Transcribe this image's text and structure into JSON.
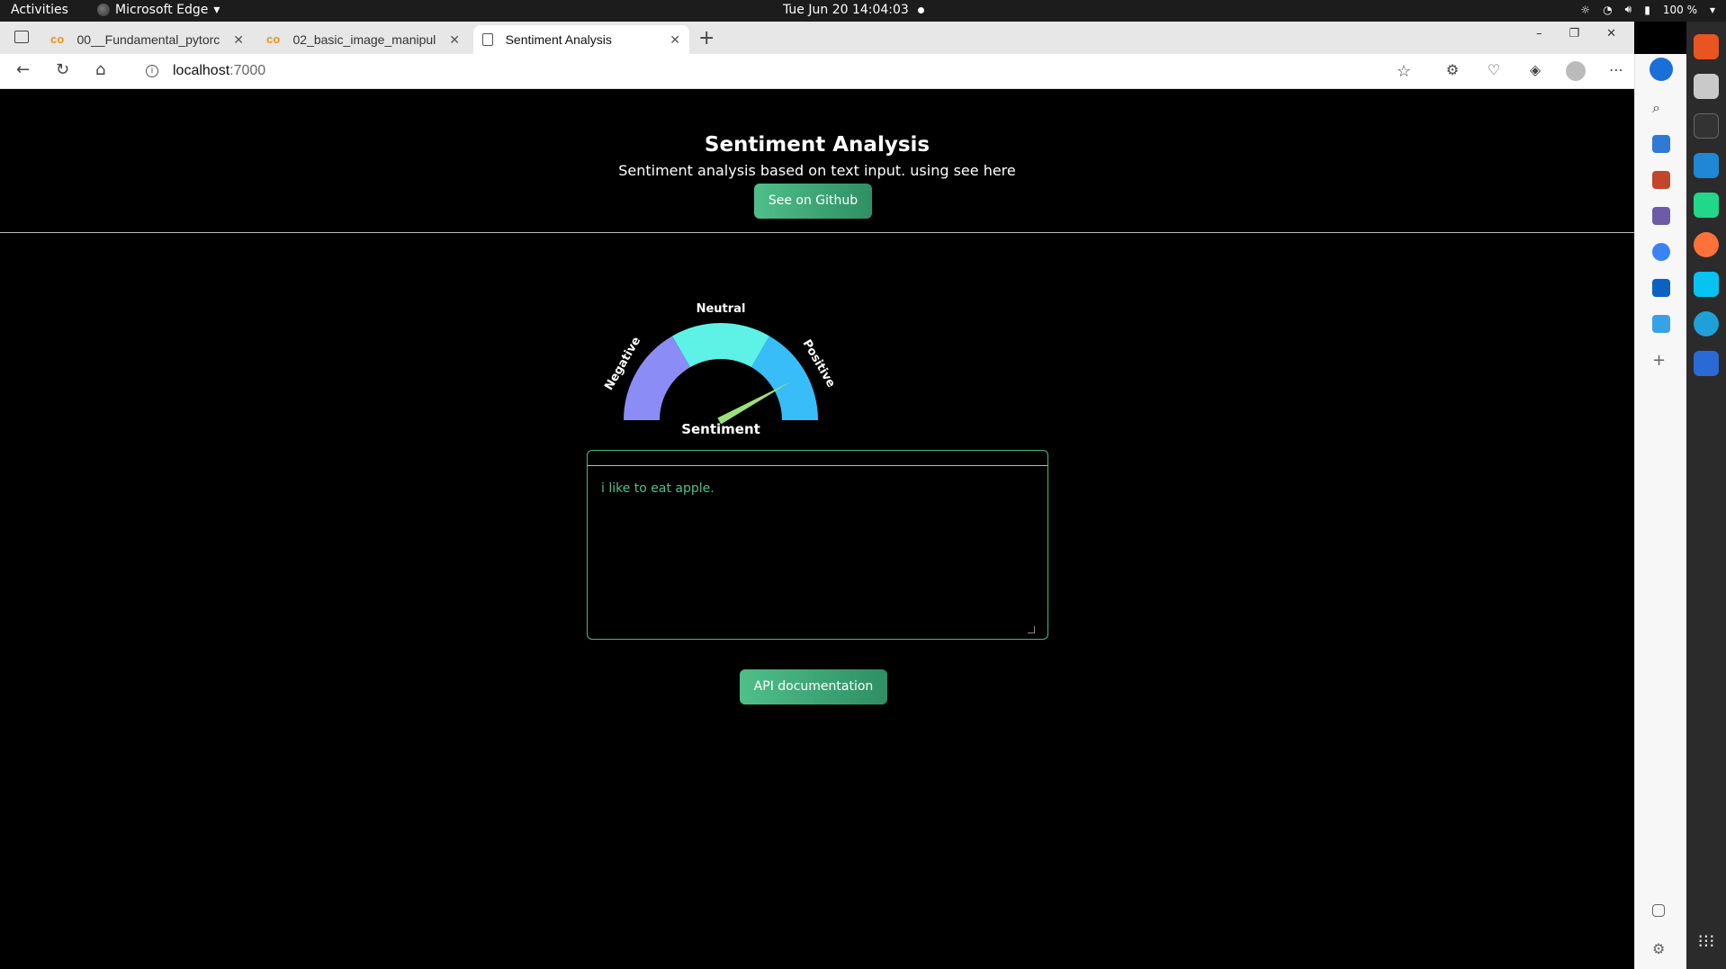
{
  "os_topbar": {
    "activities": "Activities",
    "app_name": "Microsoft Edge",
    "datetime": "Tue Jun 20  14:04:03",
    "battery": "100 %"
  },
  "browser": {
    "tabs": [
      {
        "title": "00__Fundamental_pytorc",
        "active": false
      },
      {
        "title": "02_basic_image_manipul",
        "active": false
      },
      {
        "title": "Sentiment Analysis",
        "active": true
      }
    ],
    "url_host": "localhost",
    "url_port": ":7000"
  },
  "page": {
    "title": "Sentiment Analysis",
    "subtitle": "Sentiment analysis based on text input. using see here",
    "github_button": "See on Github",
    "gauge": {
      "title": "Sentiment",
      "labels": [
        "Negative",
        "Neutral",
        "Positive"
      ],
      "colors": [
        "#8c8cf6",
        "#5ef2e6",
        "#38bdf8"
      ],
      "needle_color": "#9be07a",
      "needle_fraction": 0.84
    },
    "text_input": "i like to eat apple.",
    "api_button": "API documentation"
  },
  "colors": {
    "accent_green": "#3fbf86",
    "page_bg": "#000000"
  }
}
